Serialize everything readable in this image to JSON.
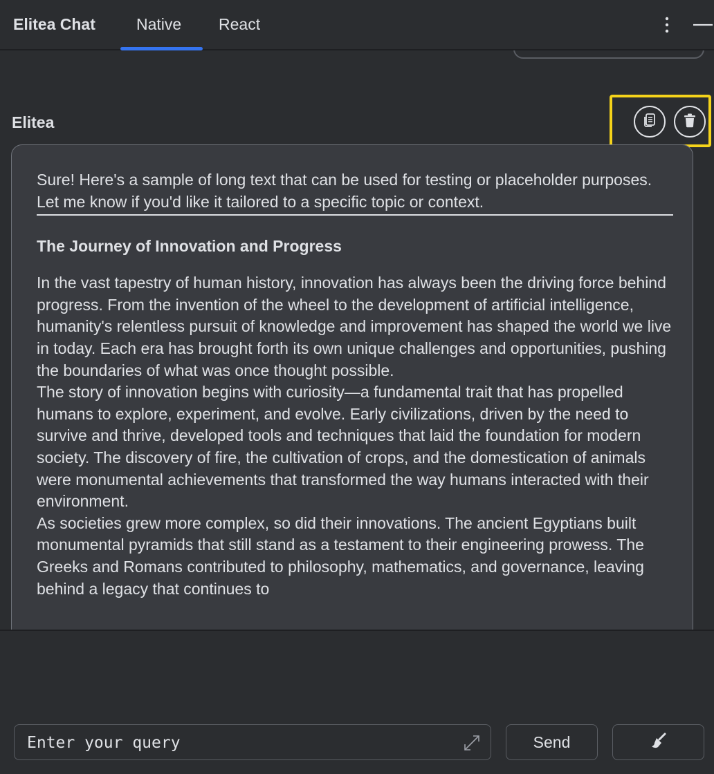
{
  "header": {
    "app_title": "Elitea Chat",
    "tabs": [
      {
        "label": "Native",
        "active": true
      },
      {
        "label": "React",
        "active": false
      }
    ],
    "icons": [
      "more-vertical-icon",
      "minimize-icon"
    ]
  },
  "message": {
    "sender": "Elitea",
    "actions": [
      {
        "icon": "copy-icon"
      },
      {
        "icon": "trash-icon"
      }
    ],
    "intro": "Sure! Here's a sample of long text that can be used for testing or placeholder purposes. Let me know if you'd like it tailored to a specific topic or context.",
    "heading": "The Journey of Innovation and Progress",
    "paragraphs": [
      "In the vast tapestry of human history, innovation has always been the driving force behind progress. From the invention of the wheel to the development of artificial intelligence, humanity's relentless pursuit of knowledge and improvement has shaped the world we live in today. Each era has brought forth its own unique challenges and opportunities, pushing the boundaries of what was once thought possible.",
      "The story of innovation begins with curiosity—a fundamental trait that has propelled humans to explore, experiment, and evolve. Early civilizations, driven by the need to survive and thrive, developed tools and techniques that laid the foundation for modern society. The discovery of fire, the cultivation of crops, and the domestication of animals were monumental achievements that transformed the way humans interacted with their environment.",
      "As societies grew more complex, so did their innovations. The ancient Egyptians built monumental pyramids that still stand as a testament to their engineering prowess. The Greeks and Romans contributed to philosophy, mathematics, and governance, leaving behind a legacy that continues to"
    ]
  },
  "input": {
    "placeholder": "Enter your query",
    "value": ""
  },
  "buttons": {
    "send_label": "Send",
    "clear_icon": "broom-icon",
    "expand_icon": "expand-icon"
  },
  "colors": {
    "background": "#2b2d30",
    "bubble": "#393b40",
    "accent": "#3574f0",
    "highlight": "#f5d31a",
    "text": "#dfe1e5"
  }
}
